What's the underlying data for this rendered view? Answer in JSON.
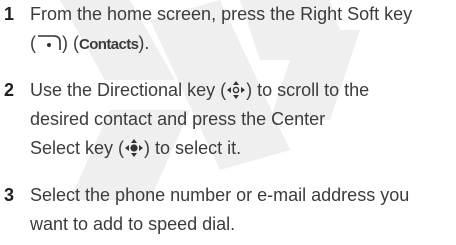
{
  "steps": [
    {
      "number": "1",
      "line1": "From the home screen, press the Right Soft key",
      "line2_open": "(",
      "line2_close": ")",
      "line2_paren_open": "(",
      "line2_bold": "Contacts",
      "line2_end": ").",
      "icon": "right-soft-key-icon"
    },
    {
      "number": "2",
      "line1_before": "Use the Directional key (",
      "line1_after": ") to scroll to the",
      "line2": "desired contact and press the Center",
      "line3_before": "Select key (",
      "line3_after": ") to select it.",
      "icons": [
        "directional-key-icon",
        "center-select-key-icon"
      ]
    },
    {
      "number": "3",
      "line1": "Select the phone number or e-mail address you",
      "line2": "want to add to speed dial."
    }
  ],
  "colors": {
    "text": "#3c3c3c",
    "watermark": "#efefef"
  }
}
